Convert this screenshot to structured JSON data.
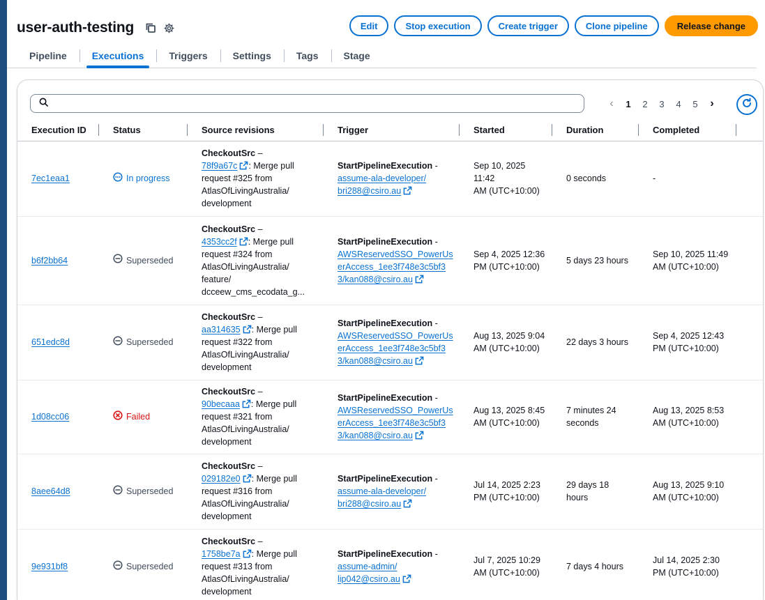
{
  "header": {
    "title": "user-auth-testing",
    "actions": {
      "edit": "Edit",
      "stop": "Stop execution",
      "create_trigger": "Create trigger",
      "clone": "Clone pipeline",
      "release": "Release change"
    }
  },
  "tabs": [
    "Pipeline",
    "Executions",
    "Triggers",
    "Settings",
    "Tags",
    "Stage"
  ],
  "active_tab": "Executions",
  "search": {
    "value": "",
    "placeholder": ""
  },
  "pagination": {
    "pages": [
      "1",
      "2",
      "3",
      "4",
      "5"
    ],
    "current": "1"
  },
  "columns": {
    "id": "Execution ID",
    "status": "Status",
    "source": "Source revisions",
    "trigger": "Trigger",
    "started": "Started",
    "duration": "Duration",
    "completed": "Completed"
  },
  "rows": [
    {
      "id": "7ec1eaa1",
      "status": "In progress",
      "source": {
        "name": "CheckoutSrc",
        "dash": " –",
        "commit": "78f9a67c",
        "msg1": ": Merge pull",
        "msg": [
          "request #325 from",
          "AtlasOfLivingAustralia/",
          "development"
        ]
      },
      "trigger": {
        "name": "StartPipelineExecution",
        "suffix": " -",
        "link": [
          "assume-ala-developer/",
          "bri288@csiro.au"
        ]
      },
      "started": [
        "Sep 10, 2025 11:42",
        "AM (UTC+10:00)"
      ],
      "duration": [
        "0 seconds"
      ],
      "completed": [
        "-"
      ]
    },
    {
      "id": "b6f2bb64",
      "status": "Superseded",
      "source": {
        "name": "CheckoutSrc",
        "dash": " –",
        "commit": "4353cc2f",
        "msg1": ": Merge pull",
        "msg": [
          "request #324 from",
          "AtlasOfLivingAustralia/",
          "feature/",
          "dcceew_cms_ecodata_g..."
        ]
      },
      "trigger": {
        "name": "StartPipelineExecution",
        "suffix": " -",
        "link": [
          "AWSReservedSSO_PowerUs",
          "erAccess_1ee3f748e3c5bf3",
          "3/kan088@csiro.au"
        ]
      },
      "started": [
        "Sep 4, 2025 12:36",
        "PM (UTC+10:00)"
      ],
      "duration": [
        "5 days 23 hours"
      ],
      "completed": [
        "Sep 10, 2025 11:49",
        "AM (UTC+10:00)"
      ]
    },
    {
      "id": "651edc8d",
      "status": "Superseded",
      "source": {
        "name": "CheckoutSrc",
        "dash": " –",
        "commit": "aa314635",
        "msg1": ": Merge pull",
        "msg": [
          "request #322 from",
          "AtlasOfLivingAustralia/",
          "development"
        ]
      },
      "trigger": {
        "name": "StartPipelineExecution",
        "suffix": " -",
        "link": [
          "AWSReservedSSO_PowerUs",
          "erAccess_1ee3f748e3c5bf3",
          "3/kan088@csiro.au"
        ]
      },
      "started": [
        "Aug 13, 2025 9:04",
        "AM (UTC+10:00)"
      ],
      "duration": [
        "22 days 3 hours"
      ],
      "completed": [
        "Sep 4, 2025 12:43",
        "PM (UTC+10:00)"
      ]
    },
    {
      "id": "1d08cc06",
      "status": "Failed",
      "source": {
        "name": "CheckoutSrc",
        "dash": " –",
        "commit": "90becaaa",
        "msg1": ": Merge pull",
        "msg": [
          "request #321 from",
          "AtlasOfLivingAustralia/",
          "development"
        ]
      },
      "trigger": {
        "name": "StartPipelineExecution",
        "suffix": " -",
        "link": [
          "AWSReservedSSO_PowerUs",
          "erAccess_1ee3f748e3c5bf3",
          "3/kan088@csiro.au"
        ]
      },
      "started": [
        "Aug 13, 2025 8:45",
        "AM (UTC+10:00)"
      ],
      "duration": [
        "7 minutes 24",
        "seconds"
      ],
      "completed": [
        "Aug 13, 2025 8:53",
        "AM (UTC+10:00)"
      ]
    },
    {
      "id": "8aee64d8",
      "status": "Superseded",
      "source": {
        "name": "CheckoutSrc",
        "dash": " –",
        "commit": "029182e0",
        "msg1": ": Merge pull",
        "msg": [
          "request #316 from",
          "AtlasOfLivingAustralia/",
          "development"
        ]
      },
      "trigger": {
        "name": "StartPipelineExecution",
        "suffix": " -",
        "link": [
          "assume-ala-developer/",
          "bri288@csiro.au"
        ]
      },
      "started": [
        "Jul 14, 2025 2:23",
        "PM (UTC+10:00)"
      ],
      "duration": [
        "29 days 18",
        "hours"
      ],
      "completed": [
        "Aug 13, 2025 9:10",
        "AM (UTC+10:00)"
      ]
    },
    {
      "id": "9e931bf8",
      "status": "Superseded",
      "source": {
        "name": "CheckoutSrc",
        "dash": " –",
        "commit": "1758be7a",
        "msg1": ": Merge pull",
        "msg": [
          "request #313 from",
          "AtlasOfLivingAustralia/",
          "development"
        ]
      },
      "trigger": {
        "name": "StartPipelineExecution",
        "suffix": " -",
        "link": [
          "assume-admin/",
          "lip042@csiro.au"
        ]
      },
      "started": [
        "Jul 7, 2025 10:29",
        "AM (UTC+10:00)"
      ],
      "duration": [
        "7 days 4 hours"
      ],
      "completed": [
        "Jul 14, 2025 2:30",
        "PM (UTC+10:00)"
      ]
    }
  ],
  "icons": {
    "copy": "copy-icon",
    "settings": "gear-icon",
    "search": "search-icon",
    "refresh": "refresh-icon",
    "external": "external-link-icon",
    "in_progress": "in-progress-icon",
    "superseded": "superseded-icon",
    "failed": "failed-icon"
  },
  "colors": {
    "accent": "#0972d3",
    "primary_button": "#ff9900",
    "failed": "#d91515",
    "frame": "#1d4e7c"
  }
}
